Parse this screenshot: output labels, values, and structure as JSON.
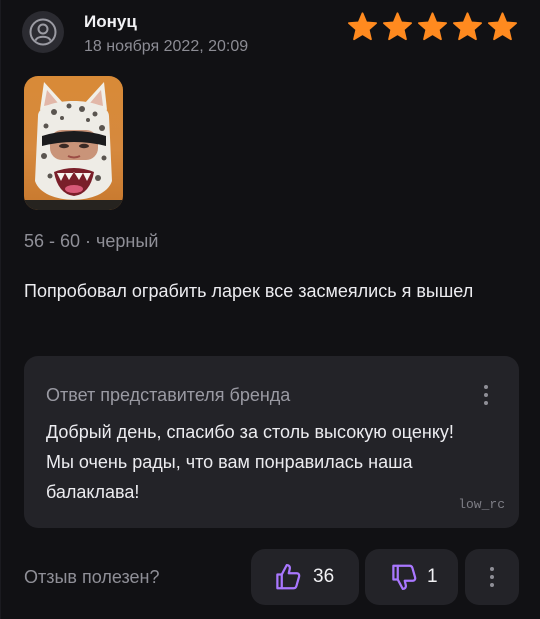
{
  "review": {
    "author": "Ионуц",
    "date": "18 ноября 2022, 20:09",
    "rating": 5,
    "rating_max": 5,
    "variant": "56 - 60 · черный",
    "text": "Попробовал ограбить ларек все засмеялись я вышел"
  },
  "reply": {
    "title": "Ответ представителя бренда",
    "text": "Добрый день, спасибо за столь высокую оценку! Мы очень рады, что вам понравилась наша балаклава!",
    "signature": "low_rc"
  },
  "footer": {
    "helpful_label": "Отзыв полезен?",
    "likes": "36",
    "dislikes": "1"
  },
  "colors": {
    "star": "#ff8a1f",
    "accent": "#a977ff",
    "background": "#111114",
    "panel": "#232328"
  },
  "icons": {
    "avatar": "user-icon",
    "like": "thumbs-up-icon",
    "dislike": "thumbs-down-icon",
    "menu": "more-vertical-icon"
  }
}
